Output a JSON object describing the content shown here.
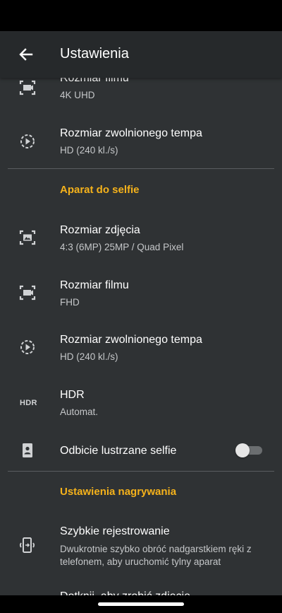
{
  "appbar": {
    "title": "Ustawienia",
    "back_icon": "arrow-left-icon"
  },
  "rows": {
    "video_size_rear": {
      "title": "Rozmiar filmu",
      "value": "4K UHD",
      "icon": "video-size-icon"
    },
    "slowmo_rear": {
      "title": "Rozmiar zwolnionego tempa",
      "value": "HD (240 kl./s)",
      "icon": "slow-motion-icon"
    },
    "photo_size_selfie": {
      "title": "Rozmiar zdjęcia",
      "value": "4:3 (6MP) 25MP / Quad Pixel",
      "icon": "photo-size-icon"
    },
    "video_size_selfie": {
      "title": "Rozmiar filmu",
      "value": "FHD",
      "icon": "video-size-icon"
    },
    "slowmo_selfie": {
      "title": "Rozmiar zwolnionego tempa",
      "value": "HD (240 kl./s)",
      "icon": "slow-motion-icon"
    },
    "hdr": {
      "title": "HDR",
      "value": "Automat.",
      "icon_label": "HDR"
    },
    "mirror_selfie": {
      "title": "Odbicie lustrzane selfie",
      "toggle_on": false,
      "icon": "portrait-icon"
    },
    "quick_capture": {
      "title": "Szybkie rejestrowanie",
      "value": "Dwukrotnie szybko obróć nadgarstkiem ręki z telefonem, aby uruchomić tylny aparat",
      "icon": "phone-twist-icon"
    },
    "next_partial": {
      "title": "Dotknij, aby zrobić zdjęcie"
    }
  },
  "sections": {
    "selfie": "Aparat do selfie",
    "recording": "Ustawienia nagrywania"
  },
  "colors": {
    "accent": "#f5b21b",
    "background": "#2f3234",
    "appbar": "#26292b"
  }
}
